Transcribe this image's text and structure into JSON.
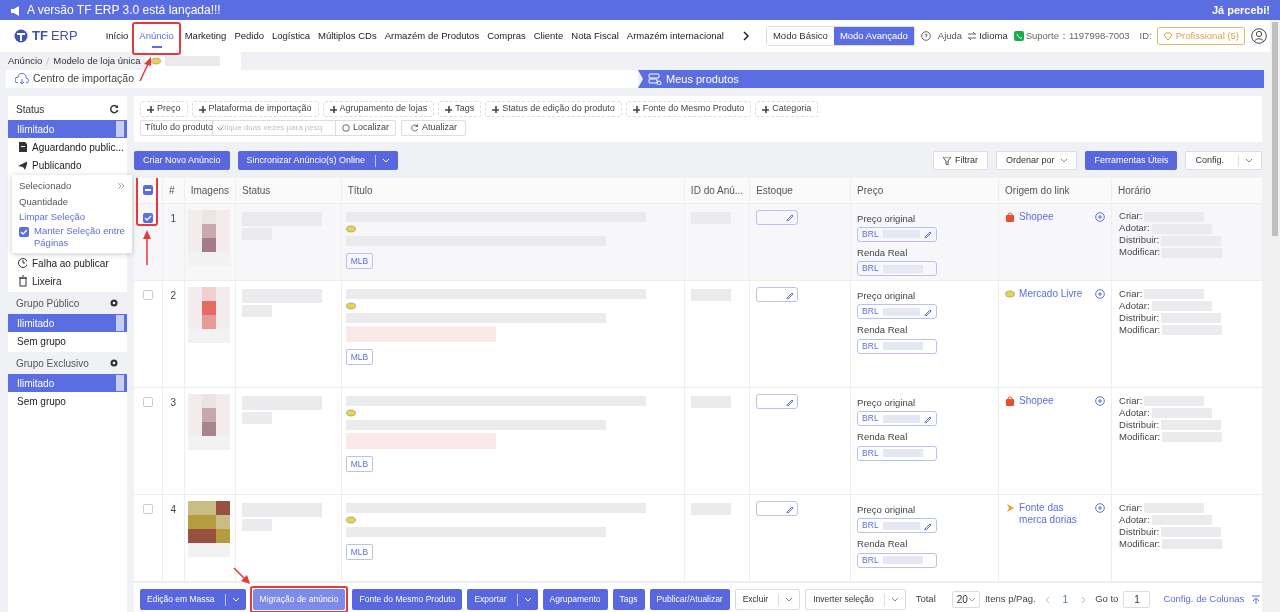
{
  "banner": {
    "message": "A versão TF ERP 3.0 está lançada!!!",
    "dismiss": "Já percebi!"
  },
  "logo": {
    "brand": "TF",
    "product": "ERP"
  },
  "nav": [
    {
      "label": "Início",
      "selected": false
    },
    {
      "label": "Anúncio",
      "selected": true
    },
    {
      "label": "Marketing",
      "selected": false
    },
    {
      "label": "Pedido",
      "selected": false
    },
    {
      "label": "Logística",
      "selected": false
    },
    {
      "label": "Múltiplos CDs",
      "selected": false
    },
    {
      "label": "Armazém de Produtos",
      "selected": false
    },
    {
      "label": "Compras",
      "selected": false
    },
    {
      "label": "Cliente",
      "selected": false
    },
    {
      "label": "Nota Fiscal",
      "selected": false
    },
    {
      "label": "Armazém internacional",
      "selected": false
    }
  ],
  "modes": [
    {
      "label": "Modo Básico",
      "selected": false
    },
    {
      "label": "Modo Avançado",
      "selected": true
    }
  ],
  "help": "Ajuda",
  "language": "Idioma",
  "support_label": "Suporte：",
  "support_phone": "1197998-7003",
  "id_label": "ID:",
  "plan": "Profissional (5)",
  "breadcrumb": [
    "Anúncio",
    "Modelo de loja única"
  ],
  "import_center": "Centro de importação",
  "my_products": "Meus produtos",
  "sidebar": [
    {
      "title": "Status",
      "kind": "refresh",
      "items": [
        {
          "label": "Ilimitado",
          "selected": true
        },
        {
          "label": "Aguardando public...",
          "selected": false,
          "kind": "document"
        },
        {
          "label": "Publicando",
          "selected": false,
          "kind": "plane"
        },
        {
          "label": "Falha ao publicar",
          "selected": false,
          "kind": "clock"
        },
        {
          "label": "Lixeira",
          "selected": false,
          "kind": "trash"
        }
      ]
    },
    {
      "title": "Grupo Público",
      "kind": "settings",
      "items": [
        {
          "label": "Ilimitado",
          "selected": true
        },
        {
          "label": "Sem grupo",
          "selected": false
        }
      ]
    },
    {
      "title": "Grupo Exclusivo",
      "kind": "settings",
      "items": [
        {
          "label": "Ilimitado",
          "selected": true
        },
        {
          "label": "Sem grupo",
          "selected": false
        }
      ]
    }
  ],
  "selection_popup": {
    "selected_label": "Selecionado",
    "quantity_label": "Quantidade",
    "clear": "Limpar Seleção",
    "keep": {
      "label": "Manter Seleção entre Páginas",
      "checked": true
    }
  },
  "filter_tags": [
    "Preço",
    "Plataforma de importação",
    "Agrupamento de lojas",
    "Tags",
    "Status de edição do produto",
    "Fonte do Mesmo Produto",
    "Categoria"
  ],
  "search": {
    "field": "Título do produto",
    "placeholder": "Clique duas vezes para pesq",
    "find": "Localizar",
    "refresh": "Atualizar"
  },
  "actions": [
    {
      "label": "Criar Novo Anúncio",
      "kind": "button"
    },
    {
      "label": "Sincronizar Anúncio(s) Online",
      "kind": "split"
    }
  ],
  "tools": [
    {
      "label": "Filtrar",
      "kind": "filter"
    },
    {
      "label": "Ordenar por",
      "kind": "dropdown"
    },
    {
      "label": "Ferramentas Úteis",
      "kind": "button"
    },
    {
      "label": "Config.",
      "kind": "split"
    }
  ],
  "table": {
    "header_checkbox": {
      "checked": true,
      "partial": true
    },
    "columns": [
      "#",
      "Imagens",
      "Status",
      "Título",
      "ID do Anú...",
      "Estoque",
      "Preço",
      "Origem do link",
      "Horário"
    ],
    "rows": [
      {
        "number": "1",
        "checked": true,
        "marketplace_tag": "MLB",
        "price_label": "Preço original",
        "price_currency": "BRL",
        "income_label": "Renda Real",
        "income_currency": "BRL",
        "origin": {
          "kind": "shopee",
          "label": "Shopee"
        },
        "time_labels": [
          "Criar:",
          "Adotar:",
          "Distribuir:",
          "Modificar:"
        ]
      },
      {
        "number": "2",
        "checked": false,
        "marketplace_tag": "MLB",
        "price_label": "Preço original",
        "price_currency": "BRL",
        "income_label": "Renda Real",
        "income_currency": "BRL",
        "origin": {
          "kind": "mercado",
          "label": "Mercado Livre"
        },
        "time_labels": [
          "Criar:",
          "Adotar:",
          "Distribuir:",
          "Modificar:"
        ]
      },
      {
        "number": "3",
        "checked": false,
        "marketplace_tag": "MLB",
        "price_label": "Preço original",
        "price_currency": "BRL",
        "income_label": "Renda Real",
        "income_currency": "BRL",
        "origin": {
          "kind": "shopee",
          "label": "Shopee"
        },
        "time_labels": [
          "Criar:",
          "Adotar:",
          "Distribuir:",
          "Modificar:"
        ]
      },
      {
        "number": "4",
        "checked": false,
        "marketplace_tag": "MLB",
        "price_label": "Preço original",
        "price_currency": "BRL",
        "income_label": "Renda Real",
        "income_currency": "BRL",
        "origin": {
          "kind": "source",
          "label": "Fonte das merca dorias"
        },
        "time_labels": [
          "Criar:",
          "Adotar:",
          "Distribuir:",
          "Modificar:"
        ]
      }
    ]
  },
  "bulk_actions": [
    {
      "label": "Edição em Massa",
      "kind": "split"
    },
    {
      "label": "Migração de anúncio",
      "kind": "light"
    },
    {
      "label": "Fonte do Mesmo Produto",
      "kind": "button"
    },
    {
      "label": "Exportar",
      "kind": "split"
    },
    {
      "label": "Agrupamento",
      "kind": "button"
    },
    {
      "label": "Tags",
      "kind": "button"
    },
    {
      "label": "Publicar/Atualizar",
      "kind": "button"
    },
    {
      "label": "Excluir",
      "kind": "outline-split"
    },
    {
      "label": "Inverter seleção",
      "kind": "outline-split"
    }
  ],
  "pagination": {
    "total_label": "Total",
    "page_size": "20",
    "per_page_label": "Itens p/Pag.",
    "current_page": "1",
    "goto_label": "Go to",
    "goto_value": "1",
    "columns_config": "Config. de Colunas"
  }
}
